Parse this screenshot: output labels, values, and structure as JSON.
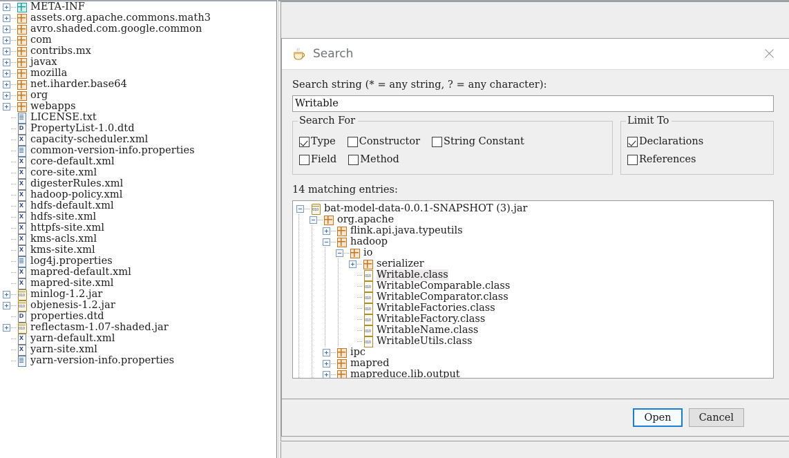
{
  "file_tree": {
    "items": [
      {
        "label": "META-INF",
        "icon": "package-teal-icon",
        "expandable": true,
        "indent": 0
      },
      {
        "label": "assets.org.apache.commons.math3",
        "icon": "package-icon",
        "expandable": true,
        "indent": 0
      },
      {
        "label": "avro.shaded.com.google.common",
        "icon": "package-icon",
        "expandable": true,
        "indent": 0
      },
      {
        "label": "com",
        "icon": "package-icon",
        "expandable": true,
        "indent": 0
      },
      {
        "label": "contribs.mx",
        "icon": "package-icon",
        "expandable": true,
        "indent": 0
      },
      {
        "label": "javax",
        "icon": "package-icon",
        "expandable": true,
        "indent": 0
      },
      {
        "label": "mozilla",
        "icon": "package-icon",
        "expandable": true,
        "indent": 0
      },
      {
        "label": "net.iharder.base64",
        "icon": "package-icon",
        "expandable": true,
        "indent": 0
      },
      {
        "label": "org",
        "icon": "package-icon",
        "expandable": true,
        "indent": 0
      },
      {
        "label": "webapps",
        "icon": "package-icon",
        "expandable": true,
        "indent": 0
      },
      {
        "label": "LICENSE.txt",
        "icon": "document-icon",
        "expandable": false,
        "indent": 0
      },
      {
        "label": "PropertyList-1.0.dtd",
        "icon": "dtd-icon",
        "expandable": false,
        "indent": 0
      },
      {
        "label": "capacity-scheduler.xml",
        "icon": "xml-icon",
        "expandable": false,
        "indent": 0
      },
      {
        "label": "common-version-info.properties",
        "icon": "document-icon",
        "expandable": false,
        "indent": 0
      },
      {
        "label": "core-default.xml",
        "icon": "xml-icon",
        "expandable": false,
        "indent": 0
      },
      {
        "label": "core-site.xml",
        "icon": "xml-icon",
        "expandable": false,
        "indent": 0
      },
      {
        "label": "digesterRules.xml",
        "icon": "xml-icon",
        "expandable": false,
        "indent": 0
      },
      {
        "label": "hadoop-policy.xml",
        "icon": "xml-icon",
        "expandable": false,
        "indent": 0
      },
      {
        "label": "hdfs-default.xml",
        "icon": "xml-icon",
        "expandable": false,
        "indent": 0
      },
      {
        "label": "hdfs-site.xml",
        "icon": "xml-icon",
        "expandable": false,
        "indent": 0
      },
      {
        "label": "httpfs-site.xml",
        "icon": "xml-icon",
        "expandable": false,
        "indent": 0
      },
      {
        "label": "kms-acls.xml",
        "icon": "xml-icon",
        "expandable": false,
        "indent": 0
      },
      {
        "label": "kms-site.xml",
        "icon": "xml-icon",
        "expandable": false,
        "indent": 0
      },
      {
        "label": "log4j.properties",
        "icon": "document-icon",
        "expandable": false,
        "indent": 0
      },
      {
        "label": "mapred-default.xml",
        "icon": "xml-icon",
        "expandable": false,
        "indent": 0
      },
      {
        "label": "mapred-site.xml",
        "icon": "xml-icon",
        "expandable": false,
        "indent": 0
      },
      {
        "label": "minlog-1.2.jar",
        "icon": "jar-icon",
        "expandable": true,
        "indent": 0
      },
      {
        "label": "objenesis-1.2.jar",
        "icon": "jar-icon",
        "expandable": true,
        "indent": 0
      },
      {
        "label": "properties.dtd",
        "icon": "dtd-icon",
        "expandable": false,
        "indent": 0
      },
      {
        "label": "reflectasm-1.07-shaded.jar",
        "icon": "jar-icon",
        "expandable": true,
        "indent": 0
      },
      {
        "label": "yarn-default.xml",
        "icon": "xml-icon",
        "expandable": false,
        "indent": 0
      },
      {
        "label": "yarn-site.xml",
        "icon": "xml-icon",
        "expandable": false,
        "indent": 0
      },
      {
        "label": "yarn-version-info.properties",
        "icon": "document-icon",
        "expandable": false,
        "indent": 0
      }
    ]
  },
  "dialog": {
    "title": "Search",
    "title_icon": "java-coffee-cup-icon",
    "close_icon": "close-icon",
    "search_string_label": "Search string (* = any string, ? = any character):",
    "search_value": "Writable",
    "search_placeholder": "",
    "search_for": {
      "title": "Search For",
      "options": [
        {
          "label": "Type",
          "checked": true
        },
        {
          "label": "Constructor",
          "checked": false
        },
        {
          "label": "String Constant",
          "checked": false
        },
        {
          "label": "Field",
          "checked": false
        },
        {
          "label": "Method",
          "checked": false
        }
      ]
    },
    "limit_to": {
      "title": "Limit To",
      "options": [
        {
          "label": "Declarations",
          "checked": true
        },
        {
          "label": "References",
          "checked": false
        }
      ]
    },
    "match_count_label": "14 matching entries:",
    "results": [
      {
        "label": "bat-model-data-0.0.1-SNAPSHOT (3).jar",
        "icon": "jar-icon",
        "state": "expanded",
        "indent": 0,
        "selected": false
      },
      {
        "label": "org.apache",
        "icon": "package-icon",
        "state": "expanded",
        "indent": 1,
        "selected": false
      },
      {
        "label": "flink.api.java.typeutils",
        "icon": "package-icon",
        "state": "collapsed",
        "indent": 2,
        "selected": false
      },
      {
        "label": "hadoop",
        "icon": "package-icon",
        "state": "expanded",
        "indent": 2,
        "selected": false
      },
      {
        "label": "io",
        "icon": "package-icon",
        "state": "expanded",
        "indent": 3,
        "selected": false
      },
      {
        "label": "serializer",
        "icon": "package-icon",
        "state": "collapsed",
        "indent": 4,
        "selected": false
      },
      {
        "label": "Writable.class",
        "icon": "class-icon",
        "state": "leaf",
        "indent": 4,
        "selected": true
      },
      {
        "label": "WritableComparable.class",
        "icon": "class-icon",
        "state": "leaf",
        "indent": 4,
        "selected": false
      },
      {
        "label": "WritableComparator.class",
        "icon": "class-icon",
        "state": "leaf",
        "indent": 4,
        "selected": false
      },
      {
        "label": "WritableFactories.class",
        "icon": "class-icon",
        "state": "leaf",
        "indent": 4,
        "selected": false
      },
      {
        "label": "WritableFactory.class",
        "icon": "class-icon",
        "state": "leaf",
        "indent": 4,
        "selected": false
      },
      {
        "label": "WritableName.class",
        "icon": "class-icon",
        "state": "leaf",
        "indent": 4,
        "selected": false
      },
      {
        "label": "WritableUtils.class",
        "icon": "class-icon",
        "state": "leaf",
        "indent": 4,
        "selected": false
      },
      {
        "label": "ipc",
        "icon": "package-icon",
        "state": "collapsed",
        "indent": 2,
        "selected": false
      },
      {
        "label": "mapred",
        "icon": "package-icon",
        "state": "collapsed",
        "indent": 2,
        "selected": false
      },
      {
        "label": "mapreduce.lib.output",
        "icon": "package-icon",
        "state": "collapsed",
        "indent": 2,
        "selected": false
      }
    ],
    "buttons": {
      "open": "Open",
      "cancel": "Cancel"
    }
  },
  "colors": {
    "accent": "#1a7fd4",
    "package_orange": "#c8731e",
    "package_teal": "#1f9e96",
    "dialog_bg": "#f0efef",
    "selection": "#eceaea"
  }
}
